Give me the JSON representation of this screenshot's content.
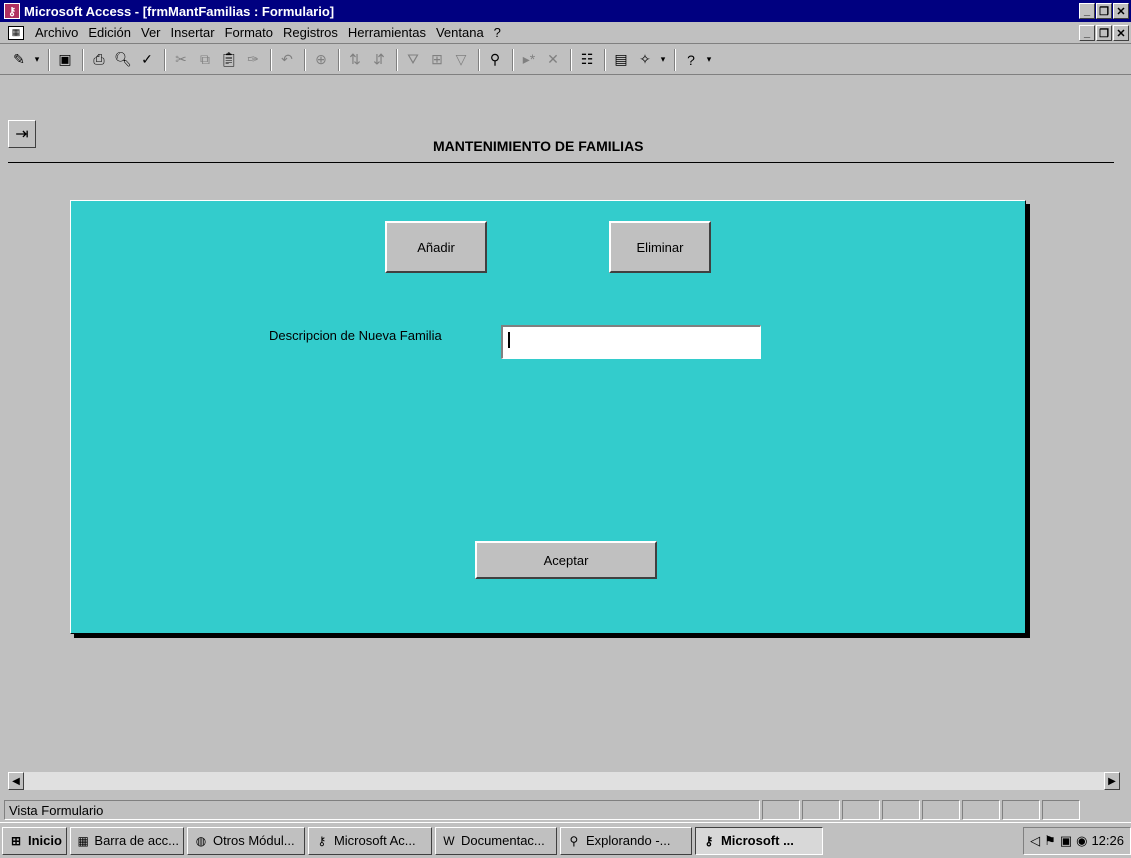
{
  "window": {
    "title": "Microsoft Access - [frmMantFamilias : Formulario]"
  },
  "menu": {
    "items": [
      {
        "label": "Archivo"
      },
      {
        "label": "Edición"
      },
      {
        "label": "Ver"
      },
      {
        "label": "Insertar"
      },
      {
        "label": "Formato"
      },
      {
        "label": "Registros"
      },
      {
        "label": "Herramientas"
      },
      {
        "label": "Ventana"
      },
      {
        "label": "?"
      }
    ]
  },
  "toolbar": {
    "icons": [
      "design-view-icon",
      "save-icon",
      "print-icon",
      "print-preview-icon",
      "spelling-icon",
      "cut-icon",
      "copy-icon",
      "paste-icon",
      "format-painter-icon",
      "undo-icon",
      "hyperlink-icon",
      "sort-ascending-icon",
      "sort-descending-icon",
      "filter-by-selection-icon",
      "filter-by-form-icon",
      "apply-filter-icon",
      "find-icon",
      "new-record-icon",
      "delete-record-icon",
      "properties-icon",
      "database-window-icon",
      "new-object-icon",
      "help-icon"
    ]
  },
  "form": {
    "title": "MANTENIMIENTO DE  FAMILIAS",
    "add_button": "Añadir",
    "delete_button": "Eliminar",
    "description_label": "Descripcion de Nueva Familia",
    "description_value": "",
    "accept_button": "Aceptar",
    "panel_color": "#33cccc"
  },
  "status": {
    "text": "Vista Formulario"
  },
  "taskbar": {
    "start": "Inicio",
    "tasks": [
      {
        "label": "Barra de acc..."
      },
      {
        "label": "Otros Módul..."
      },
      {
        "label": "Microsoft Ac..."
      },
      {
        "label": "Documentac..."
      },
      {
        "label": "Explorando -..."
      },
      {
        "label": "Microsoft ..."
      }
    ],
    "clock": "12:26"
  }
}
